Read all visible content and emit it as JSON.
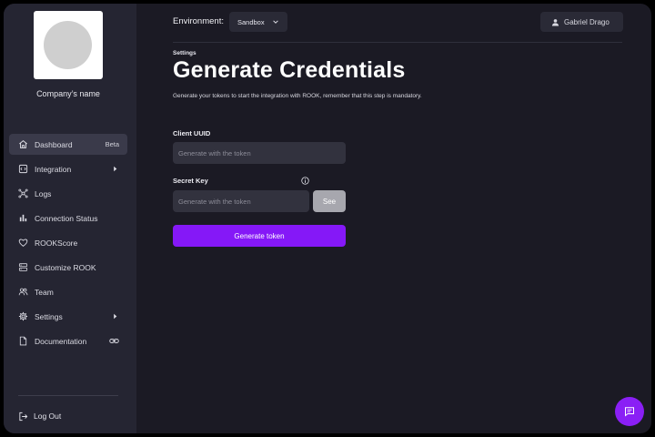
{
  "sidebar": {
    "company_name": "Company’s name",
    "items": [
      {
        "label": "Dashboard",
        "icon": "home-icon",
        "badge": "Beta"
      },
      {
        "label": "Integration",
        "icon": "integration-icon",
        "trailing": "caret-right-icon"
      },
      {
        "label": "Logs",
        "icon": "logs-network-icon"
      },
      {
        "label": "Connection Status",
        "icon": "bar-chart-icon"
      },
      {
        "label": "ROOKScore",
        "icon": "heart-icon"
      },
      {
        "label": "Customize ROOK",
        "icon": "customize-icon"
      },
      {
        "label": "Team",
        "icon": "team-icon"
      },
      {
        "label": "Settings",
        "icon": "gear-icon",
        "trailing": "caret-right-icon"
      },
      {
        "label": "Documentation",
        "icon": "document-icon",
        "trailing": "link-icon"
      }
    ],
    "logout_label": "Log Out"
  },
  "topbar": {
    "environment_label": "Environment:",
    "environment_value": "Sandbox",
    "user_name": "Gabriel Drago"
  },
  "main": {
    "breadcrumb": "Settings",
    "title": "Generate Credentials",
    "subtitle": "Generate your tokens to start the integration with ROOK, remember that this step is mandatory.",
    "client_uuid_label": "Client UUID",
    "client_uuid_placeholder": "Generate with the token",
    "secret_key_label": "Secret Key",
    "secret_key_placeholder": "Generate with the token",
    "see_label": "See",
    "generate_label": "Generate token"
  },
  "colors": {
    "accent": "#8518f7",
    "sidebar_bg": "#252532",
    "main_bg": "#1b1a24"
  }
}
